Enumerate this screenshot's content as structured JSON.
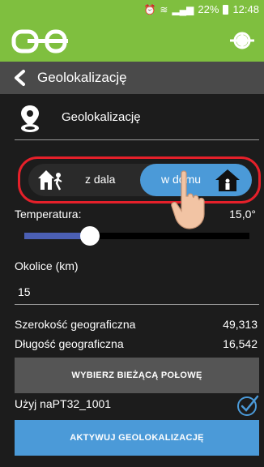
{
  "status": {
    "alarm_icon": "alarm-icon",
    "wifi_icon": "wifi-icon",
    "battery": "22%",
    "time": "12:48"
  },
  "appbar": {
    "logo_text": "BOB",
    "action_icon": "crosshair-icon",
    "accent": "#7fbf3f"
  },
  "titlebar": {
    "back_icon": "back-chevron-icon",
    "title": "Geolokalizację"
  },
  "geo": {
    "icon": "location-pin-icon",
    "label": "Geolokalizację"
  },
  "mode_toggle": {
    "away_label": "z dala",
    "home_label": "w domu",
    "selected": "home",
    "selected_color": "#4b9ad8",
    "highlight_color": "#e5202a"
  },
  "temperature": {
    "label": "Temperatura:",
    "value": "15,0°",
    "slider_fraction": 0.29
  },
  "distance": {
    "label": "Okolice (km)",
    "value": "15"
  },
  "latitude": {
    "label": "Szerokość geograficzna",
    "value": "49,313"
  },
  "longitude": {
    "label": "Długość geograficzna",
    "value": "16,542"
  },
  "buttons": {
    "pick_location": "WYBIERZ BIEŻĄCĄ POŁOWĘ",
    "activate": "AKTYWUJ GEOLOKALIZACJĘ"
  },
  "use_device": {
    "label": "Użyj naPT32_1001",
    "checked": true,
    "check_color": "#4b9ad8"
  }
}
